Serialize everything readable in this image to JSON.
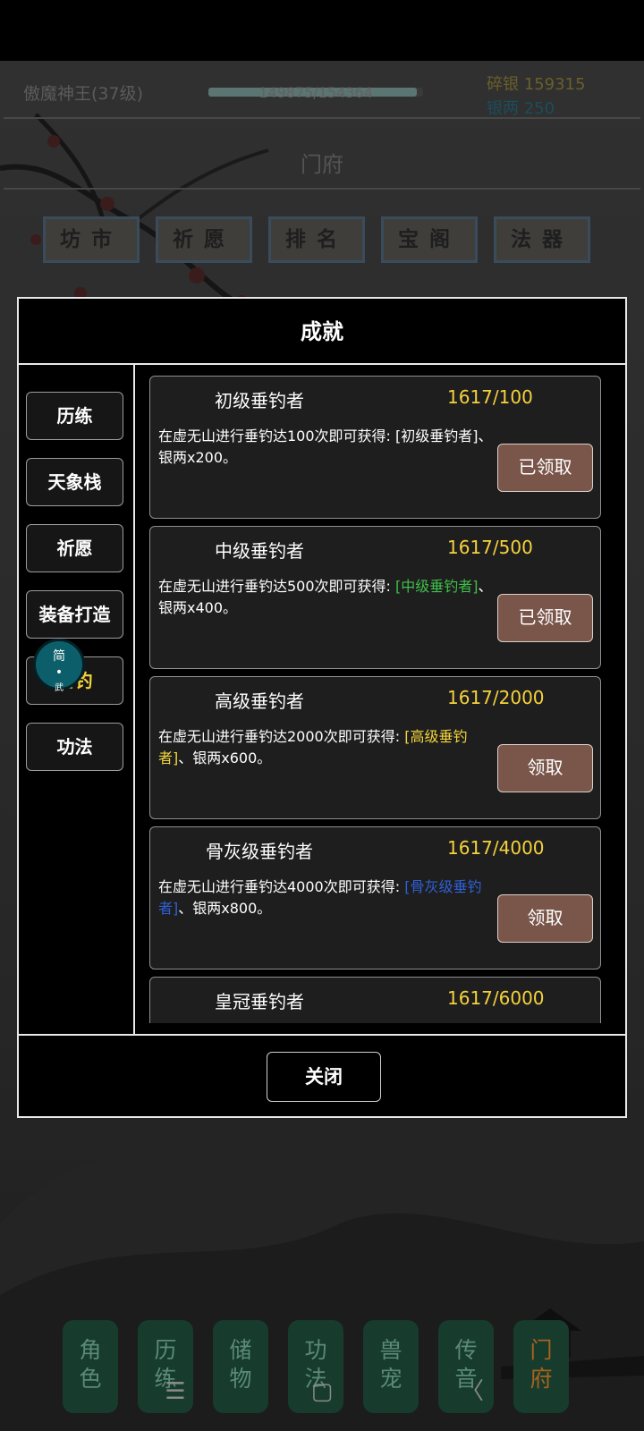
{
  "header": {
    "player_name": "傲魔神王(37级)",
    "exp_text": "149875/154364",
    "exp_fraction": 0.971,
    "broken_silver": "碎银 159315",
    "silver_taels": "银两 250",
    "section_title": "门府"
  },
  "top_tabs": [
    "坊市",
    "祈愿",
    "排名",
    "宝阁",
    "法器"
  ],
  "modal": {
    "title": "成就",
    "side_nav": [
      "历练",
      "天象栈",
      "祈愿",
      "装备打造",
      "垂钓",
      "功法"
    ],
    "float_ball": {
      "line1": "简",
      "line2": "•",
      "line3": "武"
    },
    "achievements": [
      {
        "name": "初级垂钓者",
        "progress": "1617/100",
        "desc_pre": "在虚无山进行垂钓达100次即可获得: ",
        "reward": "[初级垂钓者]",
        "reward_color": "#ffffff",
        "desc_post": "、银两x200。",
        "button": "已领取"
      },
      {
        "name": "中级垂钓者",
        "progress": "1617/500",
        "desc_pre": "在虚无山进行垂钓达500次即可获得: ",
        "reward": "[中级垂钓者]",
        "reward_color": "#3fbf4a",
        "desc_post": "、银两x400。",
        "button": "已领取"
      },
      {
        "name": "高级垂钓者",
        "progress": "1617/2000",
        "desc_pre": "在虚无山进行垂钓达2000次即可获得: ",
        "reward": "[高级垂钓者]",
        "reward_color": "#f2d43a",
        "desc_post": "、银两x600。",
        "button": "领取"
      },
      {
        "name": "骨灰级垂钓者",
        "progress": "1617/4000",
        "desc_pre": "在虚无山进行垂钓达4000次即可获得: ",
        "reward": "[骨灰级垂钓者]",
        "reward_color": "#2f5fd6",
        "desc_post": "、银两x800。",
        "button": "领取"
      },
      {
        "name": "皇冠垂钓者",
        "progress": "1617/6000"
      }
    ],
    "close_label": "关闭"
  },
  "bottom_nav": [
    {
      "label": "角\n色",
      "active": false
    },
    {
      "label": "历\n练",
      "active": false
    },
    {
      "label": "储\n物",
      "active": false
    },
    {
      "label": "功\n法",
      "active": false
    },
    {
      "label": "兽\n宠",
      "active": false
    },
    {
      "label": "传\n音",
      "active": false
    },
    {
      "label": "门\n府",
      "active": true
    }
  ],
  "system_bar": {
    "menu": "☰",
    "home": "▢",
    "back": "〈"
  },
  "colors": {
    "gold": "#f6d23c",
    "claimed_button": "#7a564a",
    "nav_green": "#173b2d",
    "nav_active_text": "#a8641c"
  }
}
